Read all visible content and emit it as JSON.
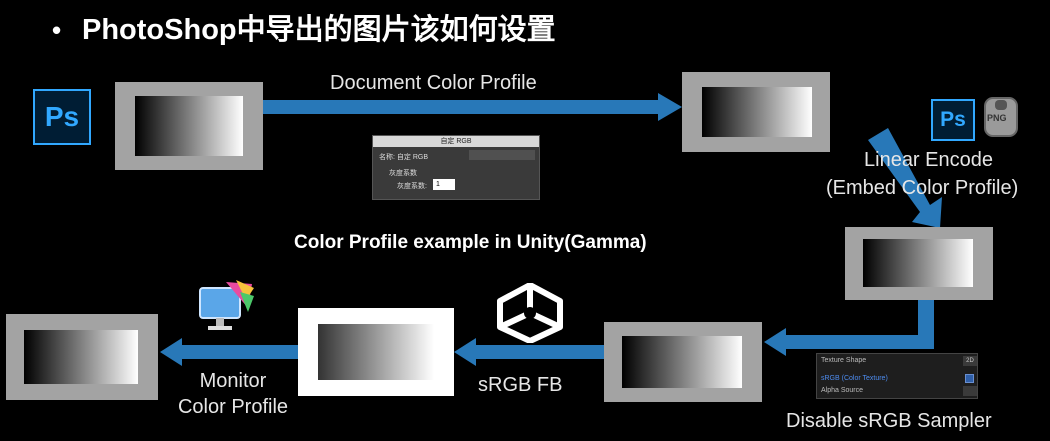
{
  "title": "PhotoShop中导出的图片该如何设置",
  "bullet": "•",
  "labels": {
    "document_color_profile": "Document Color Profile",
    "linear_encode": "Linear Encode",
    "embed_color_profile": "(Embed Color Profile)",
    "example_caption": "Color Profile example in Unity(Gamma)",
    "srgb_fb": "sRGB FB",
    "monitor": "Monitor",
    "color_profile": "Color Profile",
    "disable_srgb_sampler": "Disable sRGB Sampler"
  },
  "icons": {
    "ps_icon_text": "Ps",
    "png_badge": "PNG"
  },
  "rgb_dialog": {
    "header": "自定 RGB",
    "name_label": "名称: 自定 RGB",
    "gamma_section": "灰度系数",
    "gamma_label": "灰度系数:",
    "gamma_value": "1"
  },
  "texture_panel": {
    "texture_shape_label": "Texture Shape",
    "texture_shape_value": "2D",
    "srgb_label": "sRGB (Color Texture)",
    "alpha_source_label": "Alpha Source"
  },
  "colors": {
    "arrow": "#2878b8",
    "frame_gray": "#a3a3a3",
    "frame_white": "#ffffff",
    "ps_blue": "#31a8ff",
    "ps_bg": "#001d34"
  }
}
